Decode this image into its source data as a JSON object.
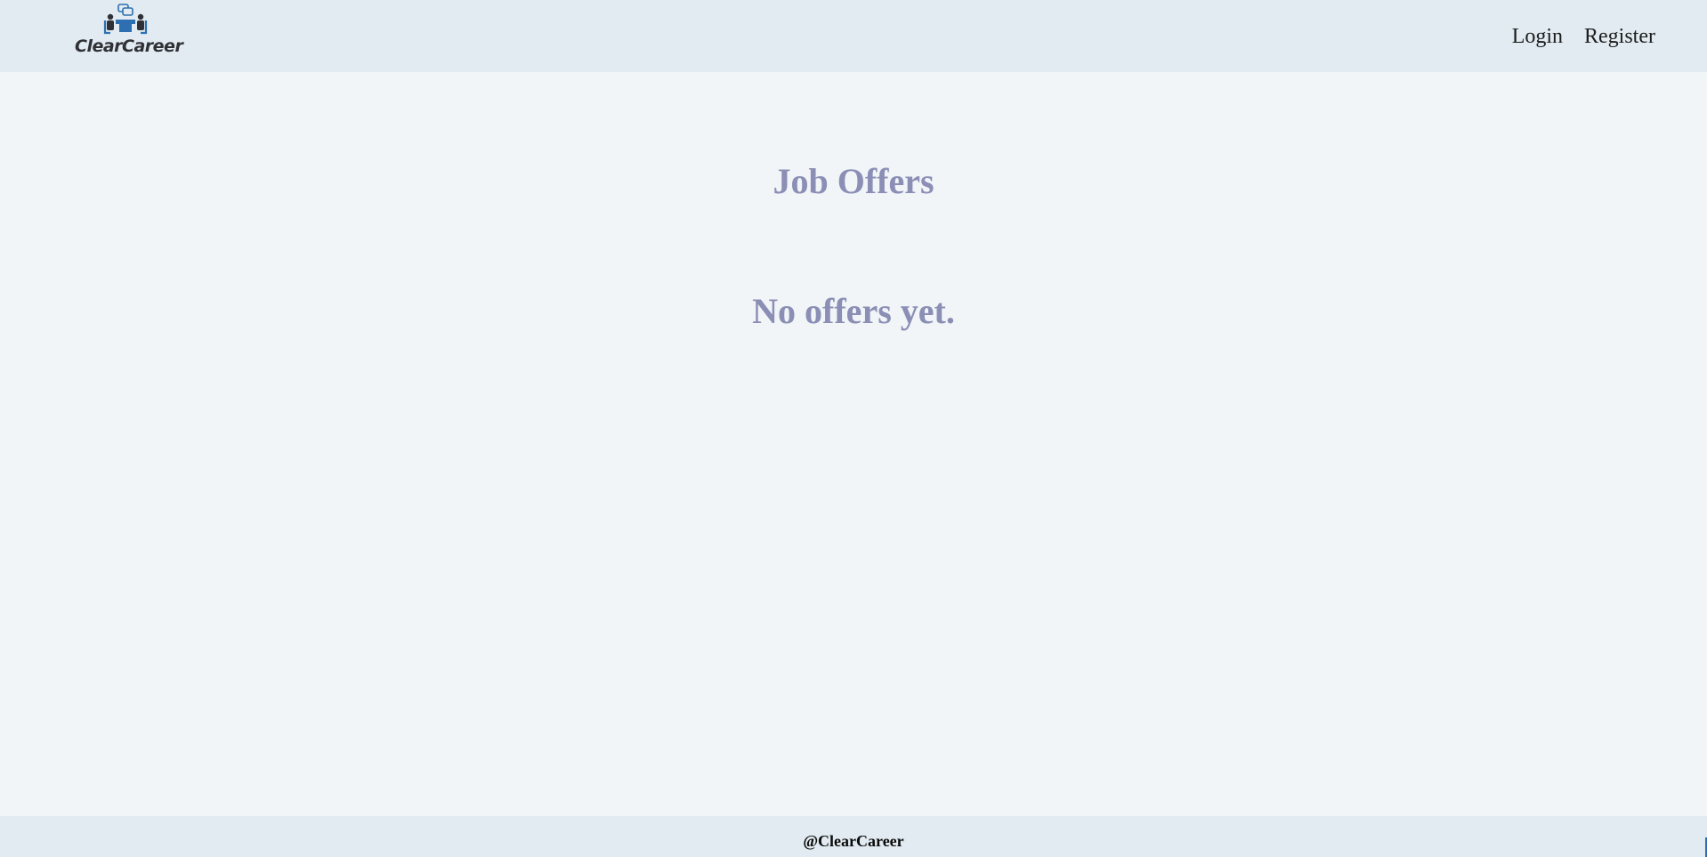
{
  "header": {
    "logo_text": "ClearCareer",
    "nav": {
      "login": "Login",
      "register": "Register"
    }
  },
  "main": {
    "title": "Job Offers",
    "empty_message": "No offers yet."
  },
  "footer": {
    "text": "@ClearCareer"
  },
  "colors": {
    "header_bg": "#e1ebf1",
    "page_bg": "#f1f5f7",
    "heading": "#8b8eb5",
    "logo_blue": "#2d6fb1",
    "logo_dark": "#2f3136"
  },
  "icons": {
    "logo": "interview-table-icon"
  }
}
